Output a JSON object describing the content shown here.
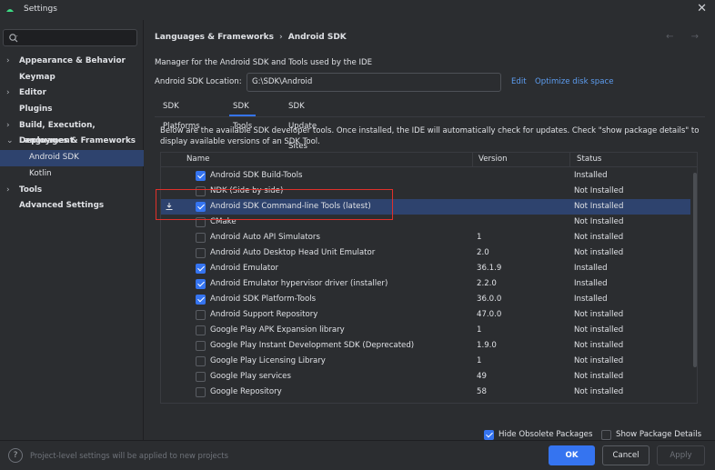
{
  "window": {
    "title": "Settings"
  },
  "sidebar": {
    "search_placeholder": "",
    "items": [
      {
        "label": "Appearance & Behavior",
        "expandable": true,
        "chevron": "›"
      },
      {
        "label": "Keymap",
        "expandable": false,
        "chevron": ""
      },
      {
        "label": "Editor",
        "expandable": true,
        "chevron": "›"
      },
      {
        "label": "Plugins",
        "expandable": false,
        "chevron": ""
      },
      {
        "label": "Build, Execution, Deployment",
        "expandable": true,
        "chevron": "›"
      },
      {
        "label": "Languages & Frameworks",
        "expandable": true,
        "chevron": "⌄"
      },
      {
        "label": "Android SDK",
        "expandable": false,
        "chevron": ""
      },
      {
        "label": "Kotlin",
        "expandable": false,
        "chevron": ""
      },
      {
        "label": "Tools",
        "expandable": true,
        "chevron": "›"
      },
      {
        "label": "Advanced Settings",
        "expandable": false,
        "chevron": ""
      }
    ]
  },
  "main": {
    "breadcrumb": [
      "Languages & Frameworks",
      "Android SDK"
    ],
    "breadcrumb_sep": "›",
    "nav_arrows": "← →",
    "description": "Manager for the Android SDK and Tools used by the IDE",
    "location_label": "Android SDK Location:",
    "location_value": "G:\\SDK\\Android",
    "edit_link": "Edit",
    "optimize_link": "Optimize disk space",
    "tabs": [
      "SDK Platforms",
      "SDK Tools",
      "SDK Update Sites"
    ],
    "active_tab": 1,
    "info_text": "Below are the available SDK developer tools. Once installed, the IDE will automatically check for updates. Check \"show package details\" to display available versions of an SDK Tool."
  },
  "table": {
    "columns": [
      "Name",
      "Version",
      "Status"
    ],
    "rows": [
      {
        "name": "Android SDK Build-Tools",
        "version": "",
        "status": "Installed",
        "checked": true
      },
      {
        "name": "NDK (Side by side)",
        "version": "",
        "status": "Not Installed",
        "checked": false
      },
      {
        "name": "Android SDK Command-line Tools (latest)",
        "version": "",
        "status": "Not Installed",
        "checked": true,
        "selected": true,
        "download": true
      },
      {
        "name": "CMake",
        "version": "",
        "status": "Not Installed",
        "checked": false
      },
      {
        "name": "Android Auto API Simulators",
        "version": "1",
        "status": "Not installed",
        "checked": false
      },
      {
        "name": "Android Auto Desktop Head Unit Emulator",
        "version": "2.0",
        "status": "Not installed",
        "checked": false
      },
      {
        "name": "Android Emulator",
        "version": "36.1.9",
        "status": "Installed",
        "checked": true
      },
      {
        "name": "Android Emulator hypervisor driver (installer)",
        "version": "2.2.0",
        "status": "Installed",
        "checked": true
      },
      {
        "name": "Android SDK Platform-Tools",
        "version": "36.0.0",
        "status": "Installed",
        "checked": true
      },
      {
        "name": "Android Support Repository",
        "version": "47.0.0",
        "status": "Not installed",
        "checked": false
      },
      {
        "name": "Google Play APK Expansion library",
        "version": "1",
        "status": "Not installed",
        "checked": false
      },
      {
        "name": "Google Play Instant Development SDK (Deprecated)",
        "version": "1.9.0",
        "status": "Not installed",
        "checked": false
      },
      {
        "name": "Google Play Licensing Library",
        "version": "1",
        "status": "Not installed",
        "checked": false
      },
      {
        "name": "Google Play services",
        "version": "49",
        "status": "Not installed",
        "checked": false
      },
      {
        "name": "Google Repository",
        "version": "58",
        "status": "Not installed",
        "checked": false
      }
    ]
  },
  "options": {
    "hide_obsolete": {
      "label": "Hide Obsolete Packages",
      "checked": true
    },
    "show_details": {
      "label": "Show Package Details",
      "checked": false
    }
  },
  "footer": {
    "help_glyph": "?",
    "text": "Project-level settings will be applied to new projects",
    "ok_label": "OK",
    "cancel_label": "Cancel",
    "apply_label": "Apply"
  },
  "colors": {
    "accent": "#3574f0",
    "selection": "#2e436e",
    "link": "#5d9df0",
    "highlight_box": "#e0302b"
  }
}
